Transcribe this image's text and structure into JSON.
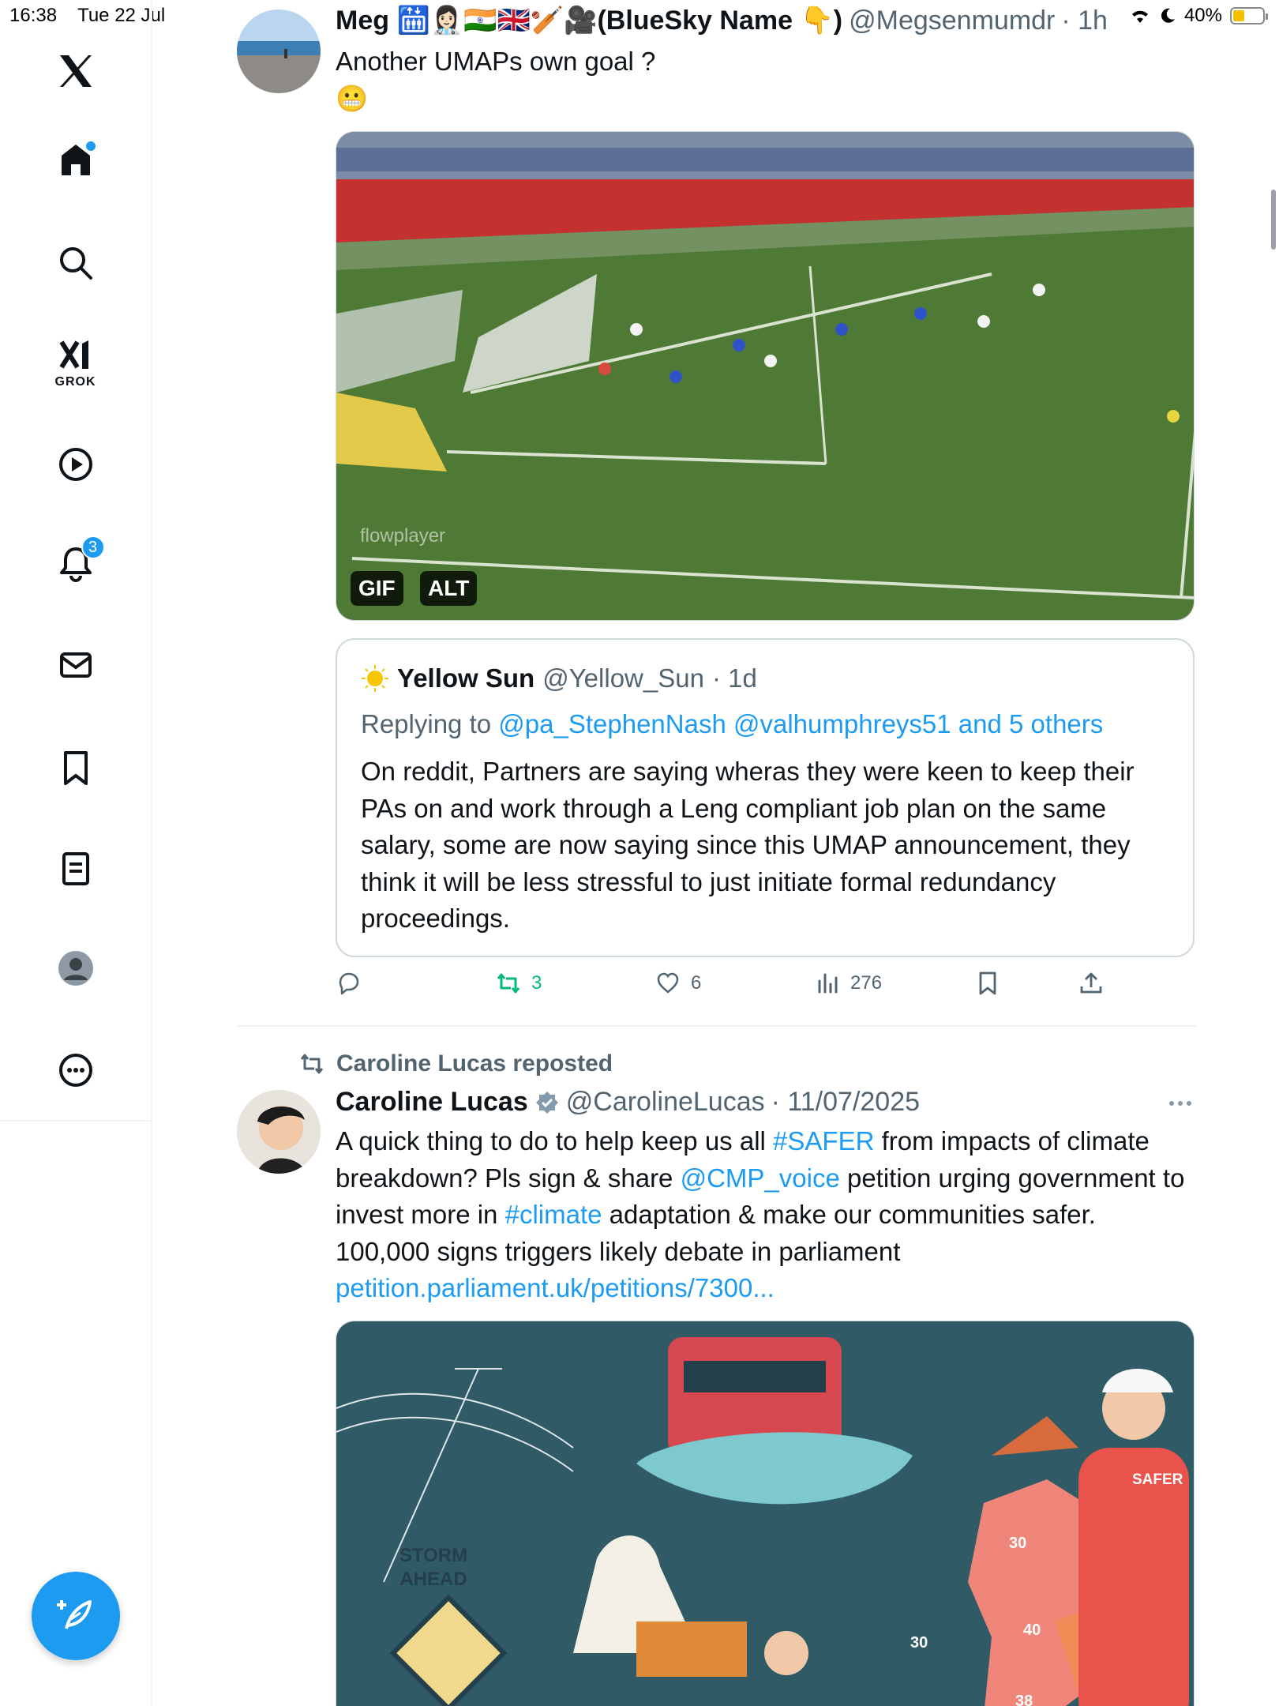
{
  "status_bar": {
    "time": "16:38",
    "date": "Tue 22 Jul",
    "battery": "40%",
    "battery_level": 0.4
  },
  "sidebar": {
    "items": [
      {
        "name": "home",
        "icon": "home-icon"
      },
      {
        "name": "search",
        "icon": "search-icon"
      },
      {
        "name": "grok",
        "icon": "grok-icon",
        "label": "GROK"
      },
      {
        "name": "video",
        "icon": "play-icon"
      },
      {
        "name": "notifications",
        "icon": "bell-icon",
        "badge": "3"
      },
      {
        "name": "messages",
        "icon": "mail-icon"
      },
      {
        "name": "bookmarks",
        "icon": "bookmark-icon"
      },
      {
        "name": "lists",
        "icon": "list-icon"
      },
      {
        "name": "profile",
        "icon": "profile-icon"
      },
      {
        "name": "more",
        "icon": "more-icon"
      }
    ],
    "compose": {
      "icon": "compose-icon"
    }
  },
  "tweet1": {
    "name": "Meg 🛗👩🏻‍⚕️🇮🇳🇬🇧🏏🎥(BlueSky Name 👇)",
    "handle": "@Megsenmumdr",
    "time": "· 1h",
    "text_line1": "Another UMAPs own goal ?",
    "text_line2": "😬",
    "media_tags": {
      "gif": "GIF",
      "alt": "ALT"
    },
    "media_watermark": "flowplayer",
    "quote": {
      "name": "Yellow Sun",
      "handle": "@Yellow_Sun",
      "time": "· 1d",
      "replying_prefix": "Replying to",
      "replying_links": "@pa_StephenNash @valhumphreys51 and 5 others",
      "text": "On reddit, Partners are saying wheras they were keen to keep their PAs on and work through a Leng compliant job plan on the same salary, some are now saying since this UMAP announcement, they think it will be less stressful to just initiate formal redundancy proceedings."
    },
    "actions": {
      "retweets": "3",
      "likes": "6",
      "views": "276"
    }
  },
  "tweet2": {
    "repost_label": "Caroline Lucas reposted",
    "name": "Caroline Lucas",
    "handle": "@CarolineLucas",
    "time": "· 11/07/2025",
    "text": {
      "p1": "A quick thing to do to help keep us all ",
      "tag1": "#SAFER",
      "p2": " from impacts of climate breakdown?  Pls sign & share ",
      "mention": "@CMP_voice",
      "p3": " petition urging government to invest more in ",
      "tag2": "#climate",
      "p4": " adaptation & make our communities safer. 100,000 signs triggers likely debate in parliament",
      "link": "petition.parliament.uk/petitions/7300..."
    },
    "image_text": {
      "sign_line1": "STORM",
      "sign_line2": "AHEAD",
      "vest": "SAFER",
      "temp1": "30",
      "temp2": "30",
      "temp3": "40",
      "temp4": "38"
    }
  },
  "colors": {
    "accent": "#1d9bf0",
    "retweet_green": "#00ba7c",
    "muted": "#536471"
  }
}
